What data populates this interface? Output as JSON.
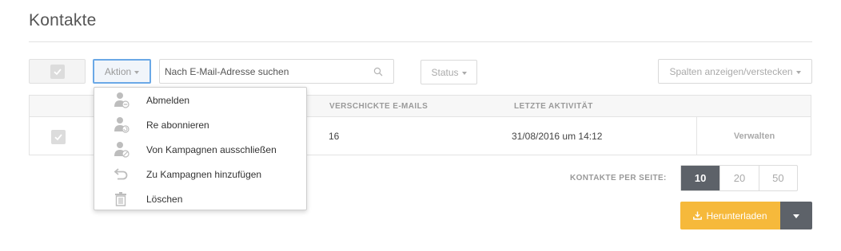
{
  "page": {
    "title": "Kontakte"
  },
  "toolbar": {
    "action_label": "Aktion",
    "search_placeholder": "Nach E-Mail-Adresse suchen",
    "status_label": "Status",
    "columns_label": "Spalten anzeigen/verstecken"
  },
  "table": {
    "headers": [
      "",
      "VERSCHICKTE E-MAILS",
      "LETZTE AKTIVITÄT"
    ],
    "rows": [
      {
        "emails_sent": "16",
        "last_activity": "31/08/2016 um 14:12",
        "manage_label": "Verwalten"
      }
    ]
  },
  "action_menu": {
    "items": [
      {
        "label": "Abmelden",
        "icon": "user-remove-icon"
      },
      {
        "label": "Re abonnieren",
        "icon": "user-resubscribe-icon"
      },
      {
        "label": "Von Kampagnen ausschließen",
        "icon": "user-exclude-icon"
      },
      {
        "label": "Zu Kampagnen hinzufügen",
        "icon": "undo-arrow-icon"
      },
      {
        "label": "Löschen",
        "icon": "trash-icon"
      }
    ]
  },
  "pagination": {
    "label": "KONTAKTE PER SEITE:",
    "options": [
      "10",
      "20",
      "50"
    ],
    "selected": "10"
  },
  "download": {
    "label": "Herunterladen"
  },
  "colors": {
    "accent_blue": "#6aa8e6",
    "download_yellow": "#f6b93b",
    "dark_gray": "#5d6269"
  }
}
